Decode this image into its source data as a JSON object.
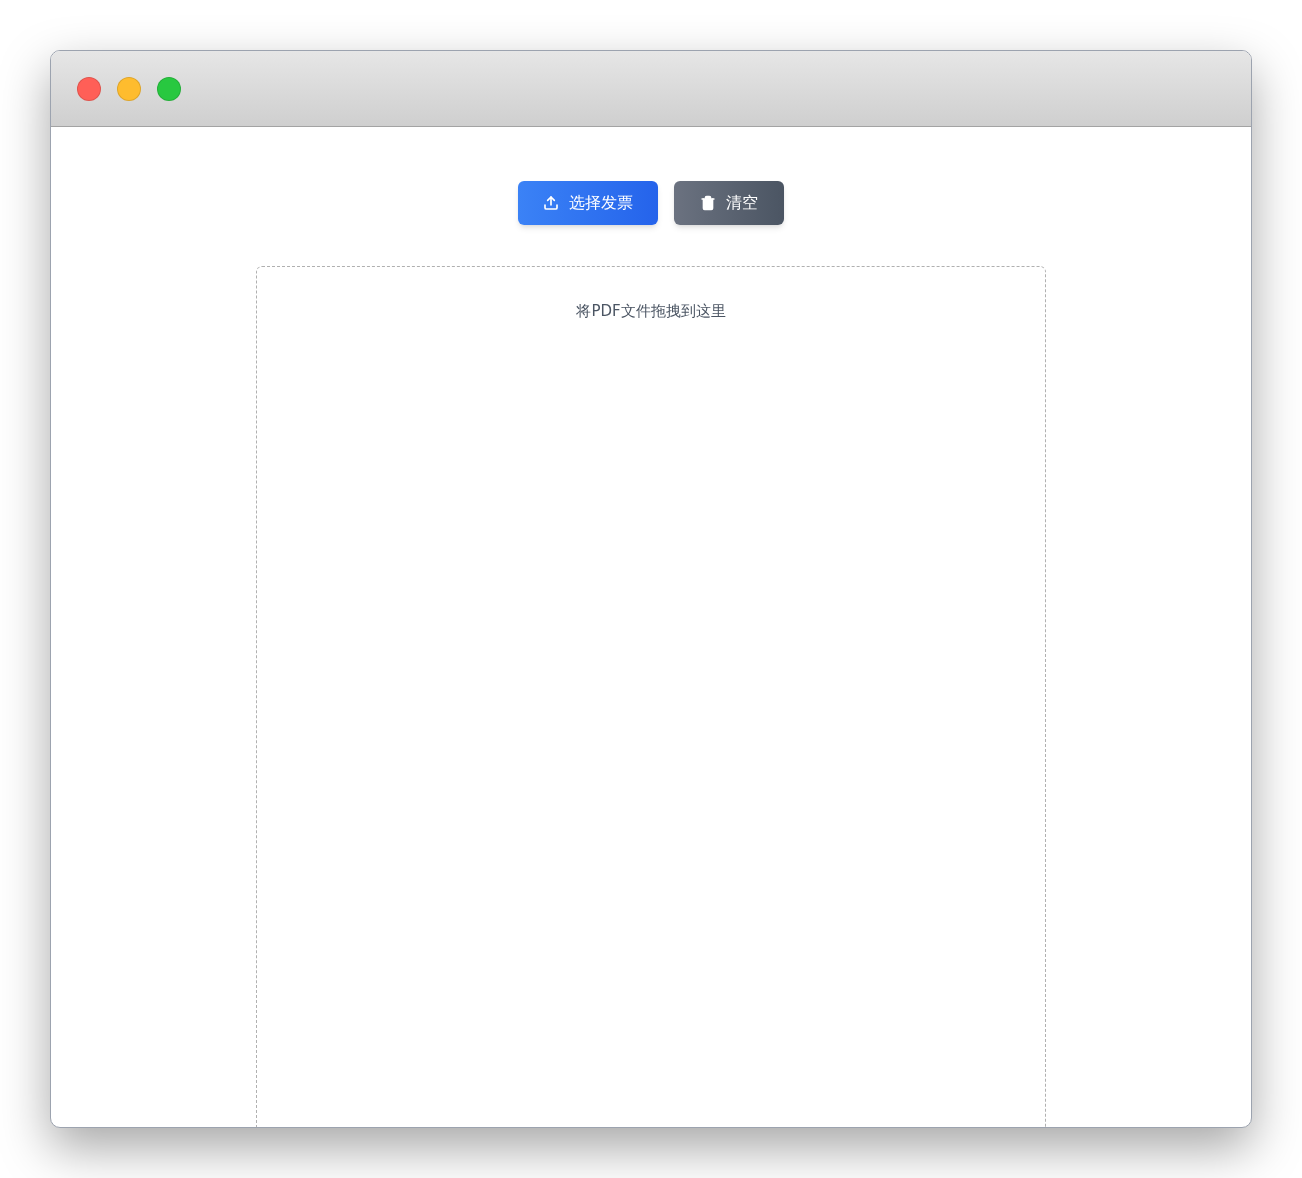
{
  "window": {
    "controls": [
      {
        "color": "#ff5f57"
      },
      {
        "color": "#febc2e"
      },
      {
        "color": "#28c840"
      }
    ]
  },
  "toolbar": {
    "buttons": [
      {
        "kind": "upload",
        "label": "选择发票"
      },
      {
        "kind": "clear",
        "label": "清空"
      }
    ]
  },
  "drop_zone": {
    "hint": "将PDF文件拖拽到这里"
  }
}
